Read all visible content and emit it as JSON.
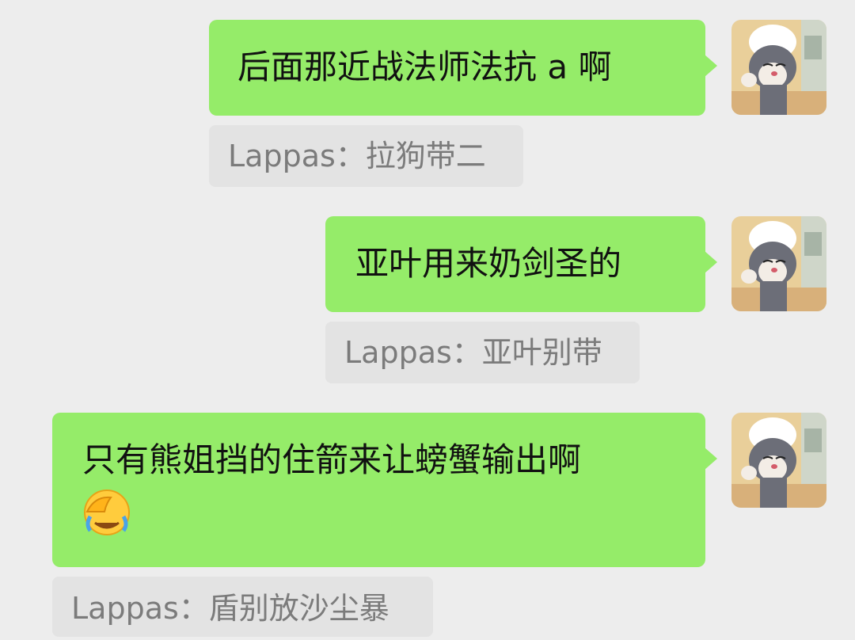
{
  "messages": [
    {
      "text": "后面那近战法师法抗 a 啊",
      "quote": "Lappas：拉狗带二"
    },
    {
      "text": "亚叶用来奶剑圣的",
      "quote": "Lappas：亚叶别带"
    },
    {
      "text": "只有熊姐挡的住箭来让螃蟹输出啊",
      "emoji": "face-palm-crying-emoji",
      "quote": "Lappas：盾别放沙尘暴"
    }
  ],
  "colors": {
    "background": "#ededed",
    "bubble": "#95ec69",
    "quote_bg": "#e3e3e3",
    "quote_text": "#7b7b7b",
    "bubble_text": "#111111"
  },
  "avatar_icon": "cartoon-cat-chef-avatar"
}
